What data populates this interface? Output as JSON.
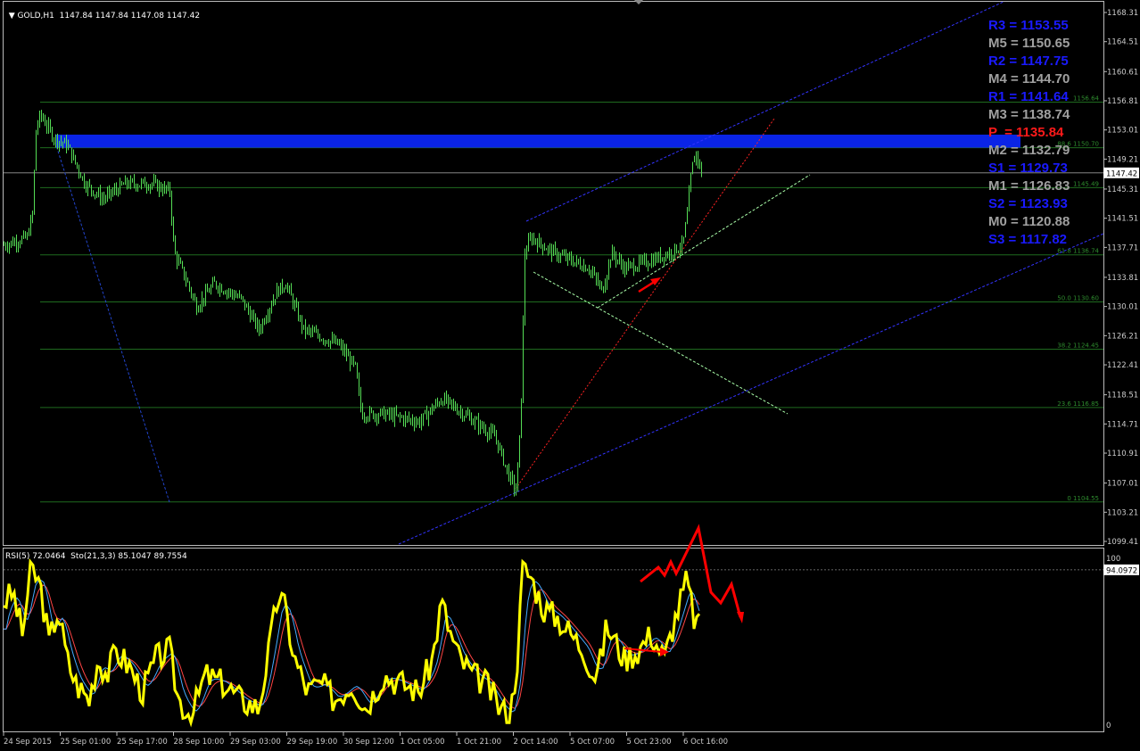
{
  "header": {
    "symbol": "GOLD,H1",
    "ohlc": "1147.84 1147.84 1147.08 1147.42"
  },
  "price_axis": {
    "ticks": [
      "1168.31",
      "1164.51",
      "1160.61",
      "1156.81",
      "1153.01",
      "1149.21",
      "1145.31",
      "1141.51",
      "1137.71",
      "1133.81",
      "1130.01",
      "1126.21",
      "1122.41",
      "1118.51",
      "1114.71",
      "1110.91",
      "1107.01",
      "1103.21",
      "1099.41"
    ],
    "current_price": "1147.42"
  },
  "pivots": [
    {
      "label": "R3 = 1153.55",
      "color": "#1a1aff"
    },
    {
      "label": "M5 = 1150.65",
      "color": "#a0a0a0"
    },
    {
      "label": "R2 = 1147.75",
      "color": "#1a1aff"
    },
    {
      "label": "M4 = 1144.70",
      "color": "#a0a0a0"
    },
    {
      "label": "R1 = 1141.64",
      "color": "#1a1aff"
    },
    {
      "label": "M3 = 1138.74",
      "color": "#a0a0a0"
    },
    {
      "label": "P  = 1135.84",
      "color": "#ff1a1a"
    },
    {
      "label": "M2 = 1132.79",
      "color": "#a0a0a0"
    },
    {
      "label": "S1 = 1129.73",
      "color": "#1a1aff"
    },
    {
      "label": "M1 = 1126.83",
      "color": "#a0a0a0"
    },
    {
      "label": "S2 = 1123.93",
      "color": "#1a1aff"
    },
    {
      "label": "M0 = 1120.88",
      "color": "#a0a0a0"
    },
    {
      "label": "S3 = 1117.82",
      "color": "#1a1aff"
    }
  ],
  "fib_levels": [
    {
      "label": "1156.64",
      "price": 1156.64
    },
    {
      "label": "88.6 1150.70",
      "price": 1150.7
    },
    {
      "label": "1145.49",
      "price": 1145.49
    },
    {
      "label": "61.8 1136.74",
      "price": 1136.74
    },
    {
      "label": "50.0 1130.60",
      "price": 1130.6
    },
    {
      "label": "38.2 1124.45",
      "price": 1124.45
    },
    {
      "label": "23.6 1116.85",
      "price": 1116.85
    },
    {
      "label": "0 1104.55",
      "price": 1104.55
    }
  ],
  "resistance_zone": {
    "from": 1150.7,
    "to": 1152.4,
    "color": "#0a24e6"
  },
  "indicator": {
    "header": "RSI(5) 72.0464  Sto(21,3,3) 85.1047 89.7554",
    "top_level": "100",
    "current_value": "94.0972",
    "bottom_level": "0"
  },
  "time_axis": [
    "24 Sep 2015",
    "25 Sep 01:00",
    "25 Sep 17:00",
    "28 Sep 10:00",
    "29 Sep 03:00",
    "29 Sep 19:00",
    "30 Sep 12:00",
    "1 Oct 05:00",
    "1 Oct 21:00",
    "2 Oct 14:00",
    "5 Oct 07:00",
    "5 Oct 23:00",
    "6 Oct 16:00"
  ],
  "chart_data": {
    "type": "line",
    "title": "GOLD,H1",
    "ylim": [
      1099.41,
      1168.31
    ],
    "series": [
      {
        "name": "GOLD,H1",
        "x": [
          "24 Sep 2015",
          "25 Sep 01:00",
          "25 Sep 17:00",
          "28 Sep 10:00",
          "29 Sep 03:00",
          "29 Sep 19:00",
          "30 Sep 12:00",
          "1 Oct 05:00",
          "1 Oct 21:00",
          "2 Oct 14:00",
          "5 Oct 07:00",
          "5 Oct 23:00",
          "6 Oct 16:00"
        ],
        "values": [
          1138.0,
          1152.0,
          1145.0,
          1131.0,
          1128.0,
          1126.5,
          1116.5,
          1116.0,
          1106.0,
          1137.5,
          1134.0,
          1137.0,
          1147.42
        ]
      }
    ]
  },
  "colors": {
    "candles": "#55dd55",
    "grid_lines": "#1f6b1f",
    "rsi": "#ffff00",
    "stoch_main": "#44aaff",
    "stoch_signal": "#ff4444",
    "arrows": "#ff0000",
    "channel": "#3333ff"
  }
}
